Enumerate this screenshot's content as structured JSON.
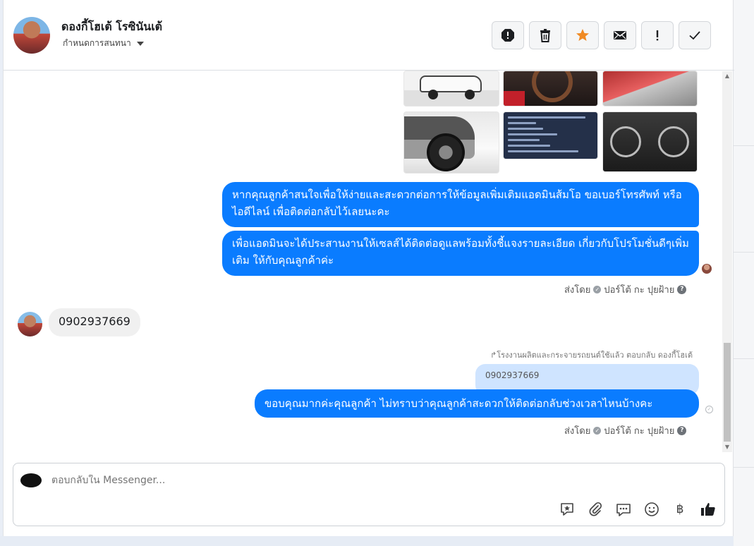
{
  "header": {
    "contact_name": "ดองกี้โฮเต้ โรซินันเต้",
    "assign_label": "กำหนดการสนทนา"
  },
  "actions": [
    {
      "name": "report-spam",
      "icon": "alert-octagon-icon"
    },
    {
      "name": "delete",
      "icon": "trash-icon"
    },
    {
      "name": "star",
      "icon": "star-icon",
      "color": "#f08a24"
    },
    {
      "name": "mark-unread",
      "icon": "envelope-icon"
    },
    {
      "name": "follow-up",
      "icon": "exclamation-icon"
    },
    {
      "name": "mark-done",
      "icon": "checkmark-icon"
    }
  ],
  "messages": {
    "out_1": "หากคุณลูกค้าสนใจเพื่อให้ง่ายและสะดวกต่อการให้ข้อมูลเพิ่มเติมแอดมินส้มโอ ขอเบอร์โทรศัพท์ หรือ ไอดีไลน์ เพื่อติดต่อกลับไว้เลยนะคะ",
    "out_2": "เพื่อแอดมินจะได้ประสานงานให้เซลส์ได้ติดต่อดูแลพร้อมทั้งชี้แจงรายละเอียด เกี่ยวกับโปรโมชั่นดีๆเพิ่มเติม ให้กับคุณลูกค้าค่ะ",
    "sent_by_label": "ส่งโดย",
    "sent_by_name": "ปอร์โต้ กะ ปุยฝ้าย",
    "incoming": "0902937669",
    "reply_meta": "โรงงานผลิตและกระจายรถยนต์ใช้แล้ว ตอบกลับ ดองกี้โฮเต้",
    "quoted_text": "0902937669",
    "out_3": "ขอบคุณมากค่ะคุณลูกค้า ไม่ทราบว่าคุณลูกค้าสะดวกให้ติดต่อกลับช่วงเวลาไหนบ้างคะ",
    "sent_by_label_2": "ส่งโดย",
    "sent_by_name_2": "ปอร์โต้ กะ ปุยฝ้าย"
  },
  "composer": {
    "placeholder": "ตอบกลับใน Messenger...",
    "currency_symbol": "฿",
    "tools": [
      "saved-reply-icon",
      "attachment-icon",
      "quick-reply-icon",
      "emoji-icon",
      "baht-icon",
      "thumbs-up-icon"
    ]
  },
  "colors": {
    "accent": "#0a7cff",
    "star": "#f08a24"
  }
}
